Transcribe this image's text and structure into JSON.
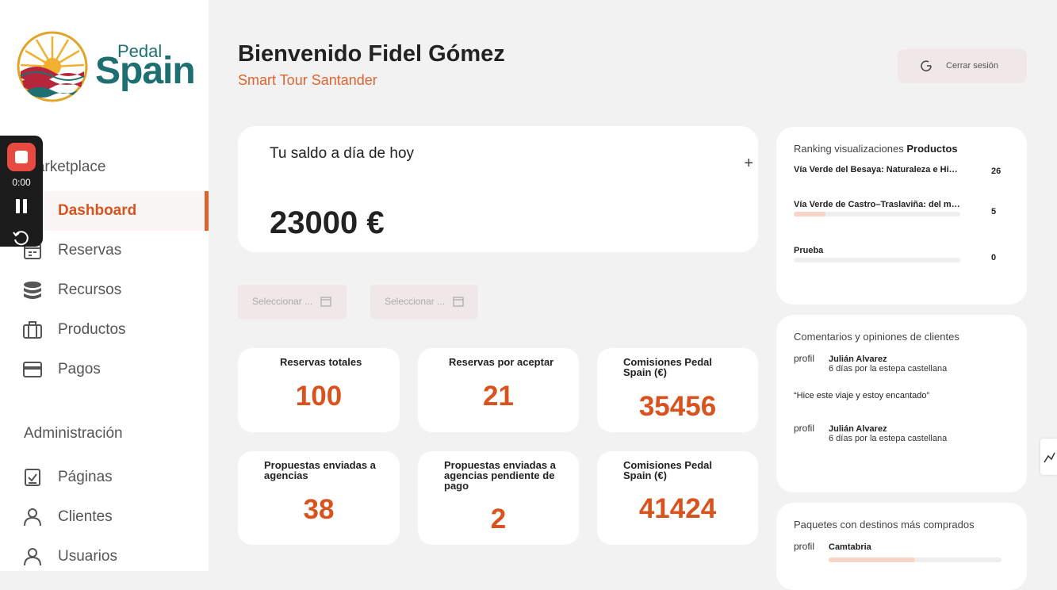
{
  "brand": {
    "pedal": "Pedal",
    "spain": "Spain"
  },
  "recorder": {
    "time": "0:00"
  },
  "sidebar": {
    "section1": "Marketplace",
    "items1": [
      {
        "label": "Dashboard",
        "icon": "grid-icon"
      },
      {
        "label": "Reservas",
        "icon": "calendar-icon"
      },
      {
        "label": "Recursos",
        "icon": "database-icon"
      },
      {
        "label": "Productos",
        "icon": "briefcase-icon"
      },
      {
        "label": "Pagos",
        "icon": "card-icon"
      }
    ],
    "section2": "Administración",
    "items2": [
      {
        "label": "Páginas",
        "icon": "page-check-icon"
      },
      {
        "label": "Clientes",
        "icon": "user-icon"
      },
      {
        "label": "Usuarios",
        "icon": "user-icon"
      }
    ]
  },
  "header": {
    "welcome": "Bienvenido Fidel Gómez",
    "subtitle": "Smart Tour Santander",
    "logout": "Cerrar sesión"
  },
  "balance": {
    "title": "Tu saldo a día de hoy",
    "plus": "+",
    "value": "23000 €"
  },
  "filters": {
    "start_placeholder": "Seleccionar ...",
    "end_placeholder": "Seleccionar ..."
  },
  "stats": [
    {
      "title": "Reservas totales",
      "value": "100"
    },
    {
      "title": "Reservas por aceptar",
      "value": "21"
    },
    {
      "title": "Comisiones Pedal Spain (€)",
      "value": "35456"
    },
    {
      "title": "Propuestas enviadas a agencias",
      "value": "38"
    },
    {
      "title": "Propuestas enviadas a agencias pendiente de pago",
      "value": "2"
    },
    {
      "title": "Comisiones Pedal Spain (€)",
      "value": "41424"
    }
  ],
  "ranking": {
    "title_prefix": "Ranking visualizaciones ",
    "title_bold": "Productos",
    "rows": [
      {
        "name": "Vía Verde del Besaya: Naturaleza e Historia",
        "count": "26",
        "fraction": 1.0
      },
      {
        "name": "Vía Verde de Castro–Traslaviña: del mar a la montaña",
        "count": "5",
        "fraction": 0.19
      },
      {
        "name": "Prueba",
        "count": "0",
        "fraction": 0.0
      }
    ]
  },
  "comments": {
    "title": "Comentarios y opiniones de clientes",
    "items": [
      {
        "avatar_alt": "profil",
        "author": "Julián Alvarez",
        "meta": "6 días por la estepa castellana",
        "text": "“Hice este viaje y estoy encantado”"
      },
      {
        "avatar_alt": "profil",
        "author": "Julián Alvarez",
        "meta": "6 días por la estepa castellana",
        "text": ""
      }
    ]
  },
  "packages": {
    "title": "Paquetes con destinos más comprados",
    "items": [
      {
        "avatar_alt": "profil",
        "name": "Camtabria",
        "fraction": 0.5
      }
    ]
  },
  "colors": {
    "accent": "#e0632f",
    "brand": "#1d6f72"
  }
}
